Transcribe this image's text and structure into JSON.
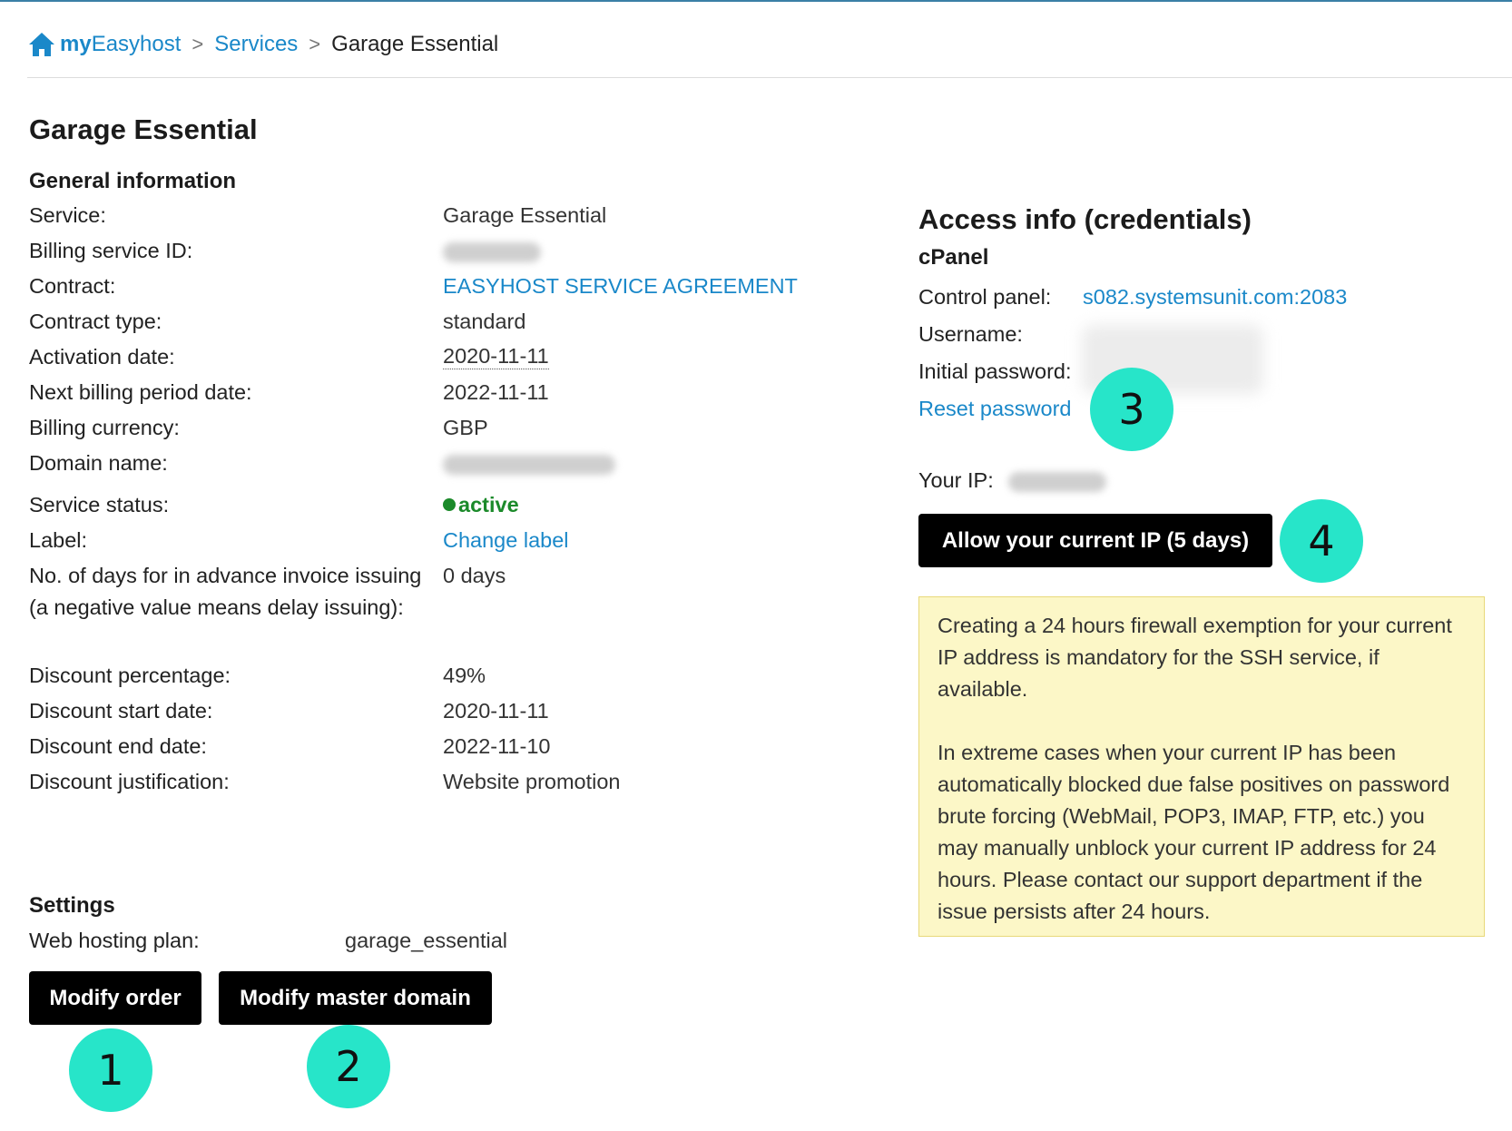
{
  "breadcrumb": {
    "brand_prefix": "my",
    "brand_suffix": "Easyhost",
    "separator": ">",
    "services": "Services",
    "current": "Garage Essential"
  },
  "page_title": "Garage Essential",
  "general": {
    "title": "General information",
    "service_label": "Service:",
    "service_value": "Garage Essential",
    "billing_id_label": "Billing service ID:",
    "contract_label": "Contract:",
    "contract_value": "EASYHOST SERVICE AGREEMENT",
    "contract_type_label": "Contract type:",
    "contract_type_value": "standard",
    "activation_label": "Activation date:",
    "activation_value": "2020-11-11",
    "next_billing_label": "Next billing period date:",
    "next_billing_value": "2022-11-11",
    "currency_label": "Billing currency:",
    "currency_value": "GBP",
    "domain_label": "Domain name:",
    "status_label": "Service status:",
    "status_value": "active",
    "label_label": "Label:",
    "label_value": "Change label",
    "advance_label_line1": "No. of days for in advance invoice issuing",
    "advance_label_line2": "(a negative value means delay issuing):",
    "advance_value": "0 days",
    "discount_pct_label": "Discount percentage:",
    "discount_pct_value": "49%",
    "discount_start_label": "Discount start date:",
    "discount_start_value": "2020-11-11",
    "discount_end_label": "Discount end date:",
    "discount_end_value": "2022-11-10",
    "discount_just_label": "Discount justification:",
    "discount_just_value": "Website promotion"
  },
  "settings": {
    "title": "Settings",
    "plan_label": "Web hosting plan:",
    "plan_value": "garage_essential",
    "modify_order": "Modify order",
    "modify_master_domain": "Modify master domain"
  },
  "access": {
    "title": "Access info (credentials)",
    "cpanel": "cPanel",
    "control_panel_label": "Control panel:",
    "control_panel_value": "s082.systemsunit.com:2083",
    "username_label": "Username:",
    "initial_password_label": "Initial password:",
    "reset_password": "Reset password",
    "your_ip_label": "Your IP:",
    "allow_ip_button": "Allow your current IP (5 days)",
    "notice_p1": "Creating a 24 hours firewall exemption for your current IP address is mandatory for the SSH service, if available.",
    "notice_p2": "In extreme cases when your current IP has been automatically blocked due false positives on password brute forcing (WebMail, POP3, IMAP, FTP, etc.) you may manually unblock your current IP address for 24 hours. Please contact our support department if the issue persists after 24 hours."
  },
  "markers": [
    "1",
    "2",
    "3",
    "4"
  ],
  "colors": {
    "link": "#1a88c9",
    "status_active": "#1b8a2a",
    "marker": "#27e5c9",
    "notice_bg": "#fcf7c7",
    "button_bg": "#000000"
  }
}
